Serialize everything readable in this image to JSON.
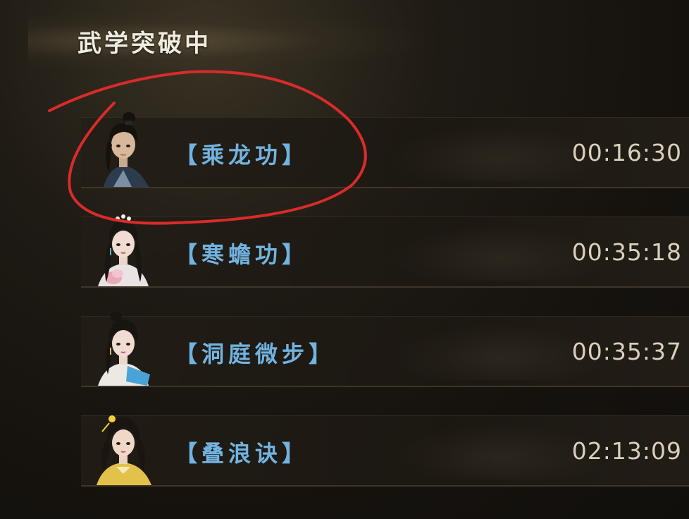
{
  "header": {
    "title": "武学突破中"
  },
  "breakthroughs": [
    {
      "skill": "【乘龙功】",
      "time_remaining": "00:16:30",
      "portrait": "young-man-topknot-portrait",
      "highlighted": true
    },
    {
      "skill": "【寒蟾功】",
      "time_remaining": "00:35:18",
      "portrait": "woman-pink-robe-portrait",
      "highlighted": false
    },
    {
      "skill": "【洞庭微步】",
      "time_remaining": "00:35:37",
      "portrait": "woman-blue-sash-portrait",
      "highlighted": false
    },
    {
      "skill": "【叠浪诀】",
      "time_remaining": "02:13:09",
      "portrait": "woman-yellow-robe-portrait",
      "highlighted": false
    }
  ],
  "colors": {
    "skill_name": "#72b3e0",
    "timer": "#d9cfbc",
    "title": "#f1ece1",
    "annotation_circle": "#d92b2b"
  }
}
